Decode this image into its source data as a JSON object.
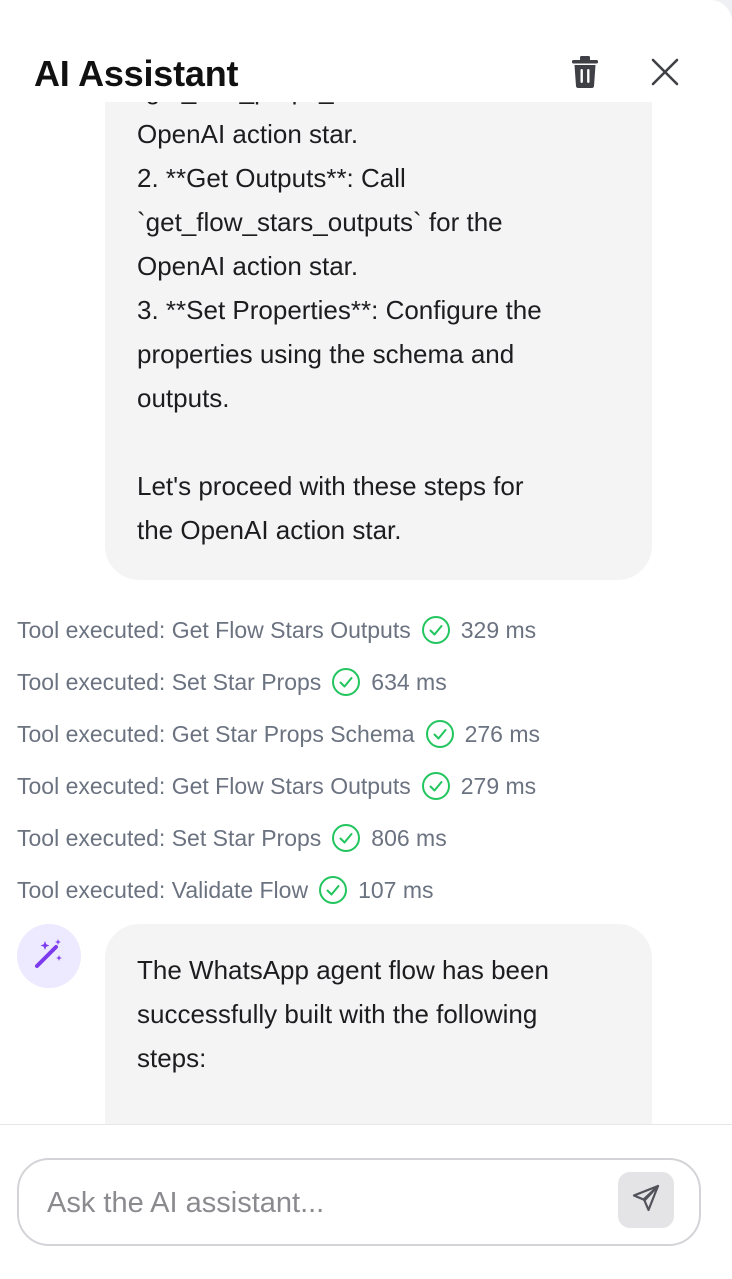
{
  "header": {
    "title": "AI Assistant",
    "clear_icon": "trash-icon",
    "close_icon": "close-icon"
  },
  "messages": {
    "assistant_top": {
      "lines": [
        "`get_star_props_schema` for the",
        "OpenAI action star.",
        "2. **Get Outputs**: Call",
        "`get_flow_stars_outputs` for the",
        "OpenAI action star.",
        "3. **Set Properties**: Configure the",
        "properties using the schema and",
        "outputs.",
        "",
        "Let's proceed with these steps for",
        "the OpenAI action star."
      ]
    },
    "tool_calls": [
      {
        "label": "Tool executed: Get Flow Stars Outputs",
        "time": "329 ms"
      },
      {
        "label": "Tool executed: Set Star Props",
        "time": "634 ms"
      },
      {
        "label": "Tool executed: Get Star Props Schema",
        "time": "276 ms"
      },
      {
        "label": "Tool executed: Get Flow Stars Outputs",
        "time": "279 ms"
      },
      {
        "label": "Tool executed: Set Star Props",
        "time": "806 ms"
      },
      {
        "label": "Tool executed: Validate Flow",
        "time": "107 ms"
      }
    ],
    "assistant_bottom": {
      "avatar_icon": "magic-wand-icon",
      "lines": [
        "The WhatsApp agent flow has been",
        "successfully built with the following",
        "steps:"
      ]
    }
  },
  "composer": {
    "value": "",
    "placeholder": "Ask the AI assistant...",
    "send_icon": "send-icon"
  },
  "colors": {
    "success": "#22c55e",
    "bubble_bg": "#f4f4f5",
    "avatar_bg": "#ede9fe",
    "avatar_icon": "#7c3aed"
  }
}
